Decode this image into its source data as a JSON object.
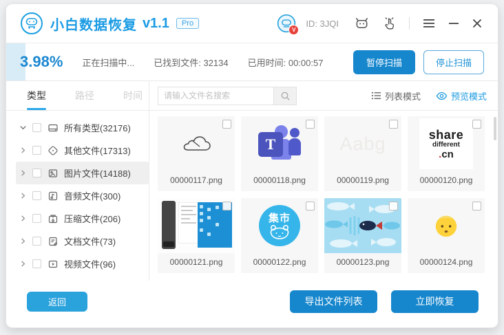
{
  "window": {
    "title": "小白数据恢复",
    "version": "v1.1",
    "badge": "Pro",
    "user_id": "ID: 3JQI",
    "avatar_badge": "V",
    "minimize": "−",
    "close": "×"
  },
  "scan": {
    "percent": "3.98%",
    "status": "正在扫描中...",
    "found": "已找到文件: 32134",
    "time": "已用时间: 00:00:57",
    "pause_button": "暂停扫描",
    "stop_button": "停止扫描"
  },
  "tabs": [
    {
      "label": "类型",
      "active": true
    },
    {
      "label": "路径",
      "active": false
    },
    {
      "label": "时间",
      "active": false
    }
  ],
  "search": {
    "placeholder": "请输入文件名搜索"
  },
  "view_modes": {
    "list": "列表模式",
    "preview": "预览模式"
  },
  "tree": {
    "items": [
      {
        "label": "所有类型(32176)",
        "icon": "drive",
        "expanded": true
      },
      {
        "label": "其他文件(17313)",
        "icon": "other"
      },
      {
        "label": "图片文件(14188)",
        "icon": "image",
        "selected": true
      },
      {
        "label": "音频文件(300)",
        "icon": "audio"
      },
      {
        "label": "压缩文件(206)",
        "icon": "archive"
      },
      {
        "label": "文档文件(73)",
        "icon": "document"
      },
      {
        "label": "视频文件(96)",
        "icon": "video"
      }
    ]
  },
  "files": [
    {
      "name": "00000117.png",
      "thumb": "onedrive-cloud-logo"
    },
    {
      "name": "00000118.png",
      "thumb": "microsoft-teams-logo",
      "letter": "T"
    },
    {
      "name": "00000119.png",
      "thumb": "faint-text",
      "preview_text": "Aabg"
    },
    {
      "name": "00000120.png",
      "thumb": "share-different-logo",
      "logo": {
        "l1": "share",
        "l2": "different",
        "dot": ".",
        "l3": "cn"
      }
    },
    {
      "name": "00000121.png",
      "thumb": "desktop-screenshot"
    },
    {
      "name": "00000122.png",
      "thumb": "jishi-bear-logo",
      "preview_text": "集市"
    },
    {
      "name": "00000123.png",
      "thumb": "fish-pattern"
    },
    {
      "name": "00000124.png",
      "thumb": "child-emoji"
    }
  ],
  "footer": {
    "back_button": "返回",
    "export_button": "导出文件列表",
    "recover_button": "立即恢复"
  },
  "colors": {
    "primary_blue": "#1787cd",
    "title_blue": "#1a9be3",
    "light_blue_button": "#2aa2dc",
    "progress_fill": "#d8ecf8",
    "tab_underline": "#2ba7e8",
    "teams_purple": "#4b53bc",
    "badge_red": "#e8423c"
  }
}
